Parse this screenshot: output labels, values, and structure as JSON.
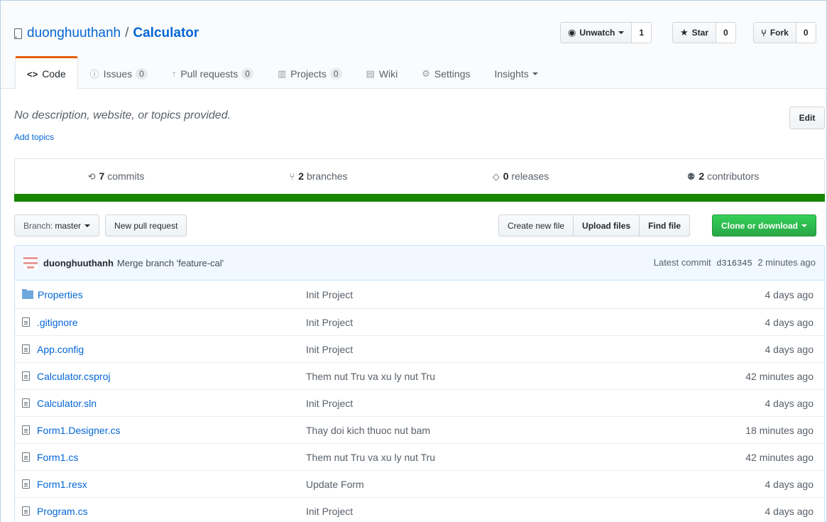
{
  "repo": {
    "owner": "duonghuuthanh",
    "separator": "/",
    "name": "Calculator"
  },
  "actions": {
    "watch": {
      "label": "Unwatch",
      "count": "1"
    },
    "star": {
      "label": "Star",
      "count": "0"
    },
    "fork": {
      "label": "Fork",
      "count": "0"
    }
  },
  "tabs": [
    {
      "label": "Code",
      "icon": "code-icon"
    },
    {
      "label": "Issues",
      "count": "0",
      "icon": "issue-icon"
    },
    {
      "label": "Pull requests",
      "count": "0",
      "icon": "pull-request-icon"
    },
    {
      "label": "Projects",
      "count": "0",
      "icon": "project-icon"
    },
    {
      "label": "Wiki",
      "icon": "book-icon"
    },
    {
      "label": "Settings",
      "icon": "gear-icon"
    },
    {
      "label": "Insights",
      "icon": ""
    }
  ],
  "about": {
    "description": "No description, website, or topics provided.",
    "add_topics": "Add topics",
    "edit": "Edit"
  },
  "summary": {
    "commits": {
      "num": "7",
      "label": "commits"
    },
    "branches": {
      "num": "2",
      "label": "branches"
    },
    "releases": {
      "num": "0",
      "label": "releases"
    },
    "contributors": {
      "num": "2",
      "label": "contributors"
    },
    "language_color": "#178600"
  },
  "filenav": {
    "branch_prefix": "Branch:",
    "branch": "master",
    "new_pr": "New pull request",
    "create_file": "Create new file",
    "upload": "Upload files",
    "find": "Find file",
    "clone": "Clone or download"
  },
  "commit": {
    "author": "duonghuuthanh",
    "message": "Merge branch 'feature-cal'",
    "latest_label": "Latest commit",
    "sha": "d316345",
    "age": "2 minutes ago"
  },
  "files": [
    {
      "name": "Properties",
      "type": "dir",
      "message": "Init Project",
      "age": "4 days ago"
    },
    {
      "name": ".gitignore",
      "type": "file",
      "message": "Init Project",
      "age": "4 days ago"
    },
    {
      "name": "App.config",
      "type": "file",
      "message": "Init Project",
      "age": "4 days ago"
    },
    {
      "name": "Calculator.csproj",
      "type": "file",
      "message": "Them nut Tru va xu ly nut Tru",
      "age": "42 minutes ago"
    },
    {
      "name": "Calculator.sln",
      "type": "file",
      "message": "Init Project",
      "age": "4 days ago"
    },
    {
      "name": "Form1.Designer.cs",
      "type": "file",
      "message": "Thay doi kich thuoc nut bam",
      "age": "18 minutes ago"
    },
    {
      "name": "Form1.cs",
      "type": "file",
      "message": "Them nut Tru va xu ly nut Tru",
      "age": "42 minutes ago"
    },
    {
      "name": "Form1.resx",
      "type": "file",
      "message": "Update Form",
      "age": "4 days ago"
    },
    {
      "name": "Program.cs",
      "type": "file",
      "message": "Init Project",
      "age": "4 days ago"
    }
  ]
}
